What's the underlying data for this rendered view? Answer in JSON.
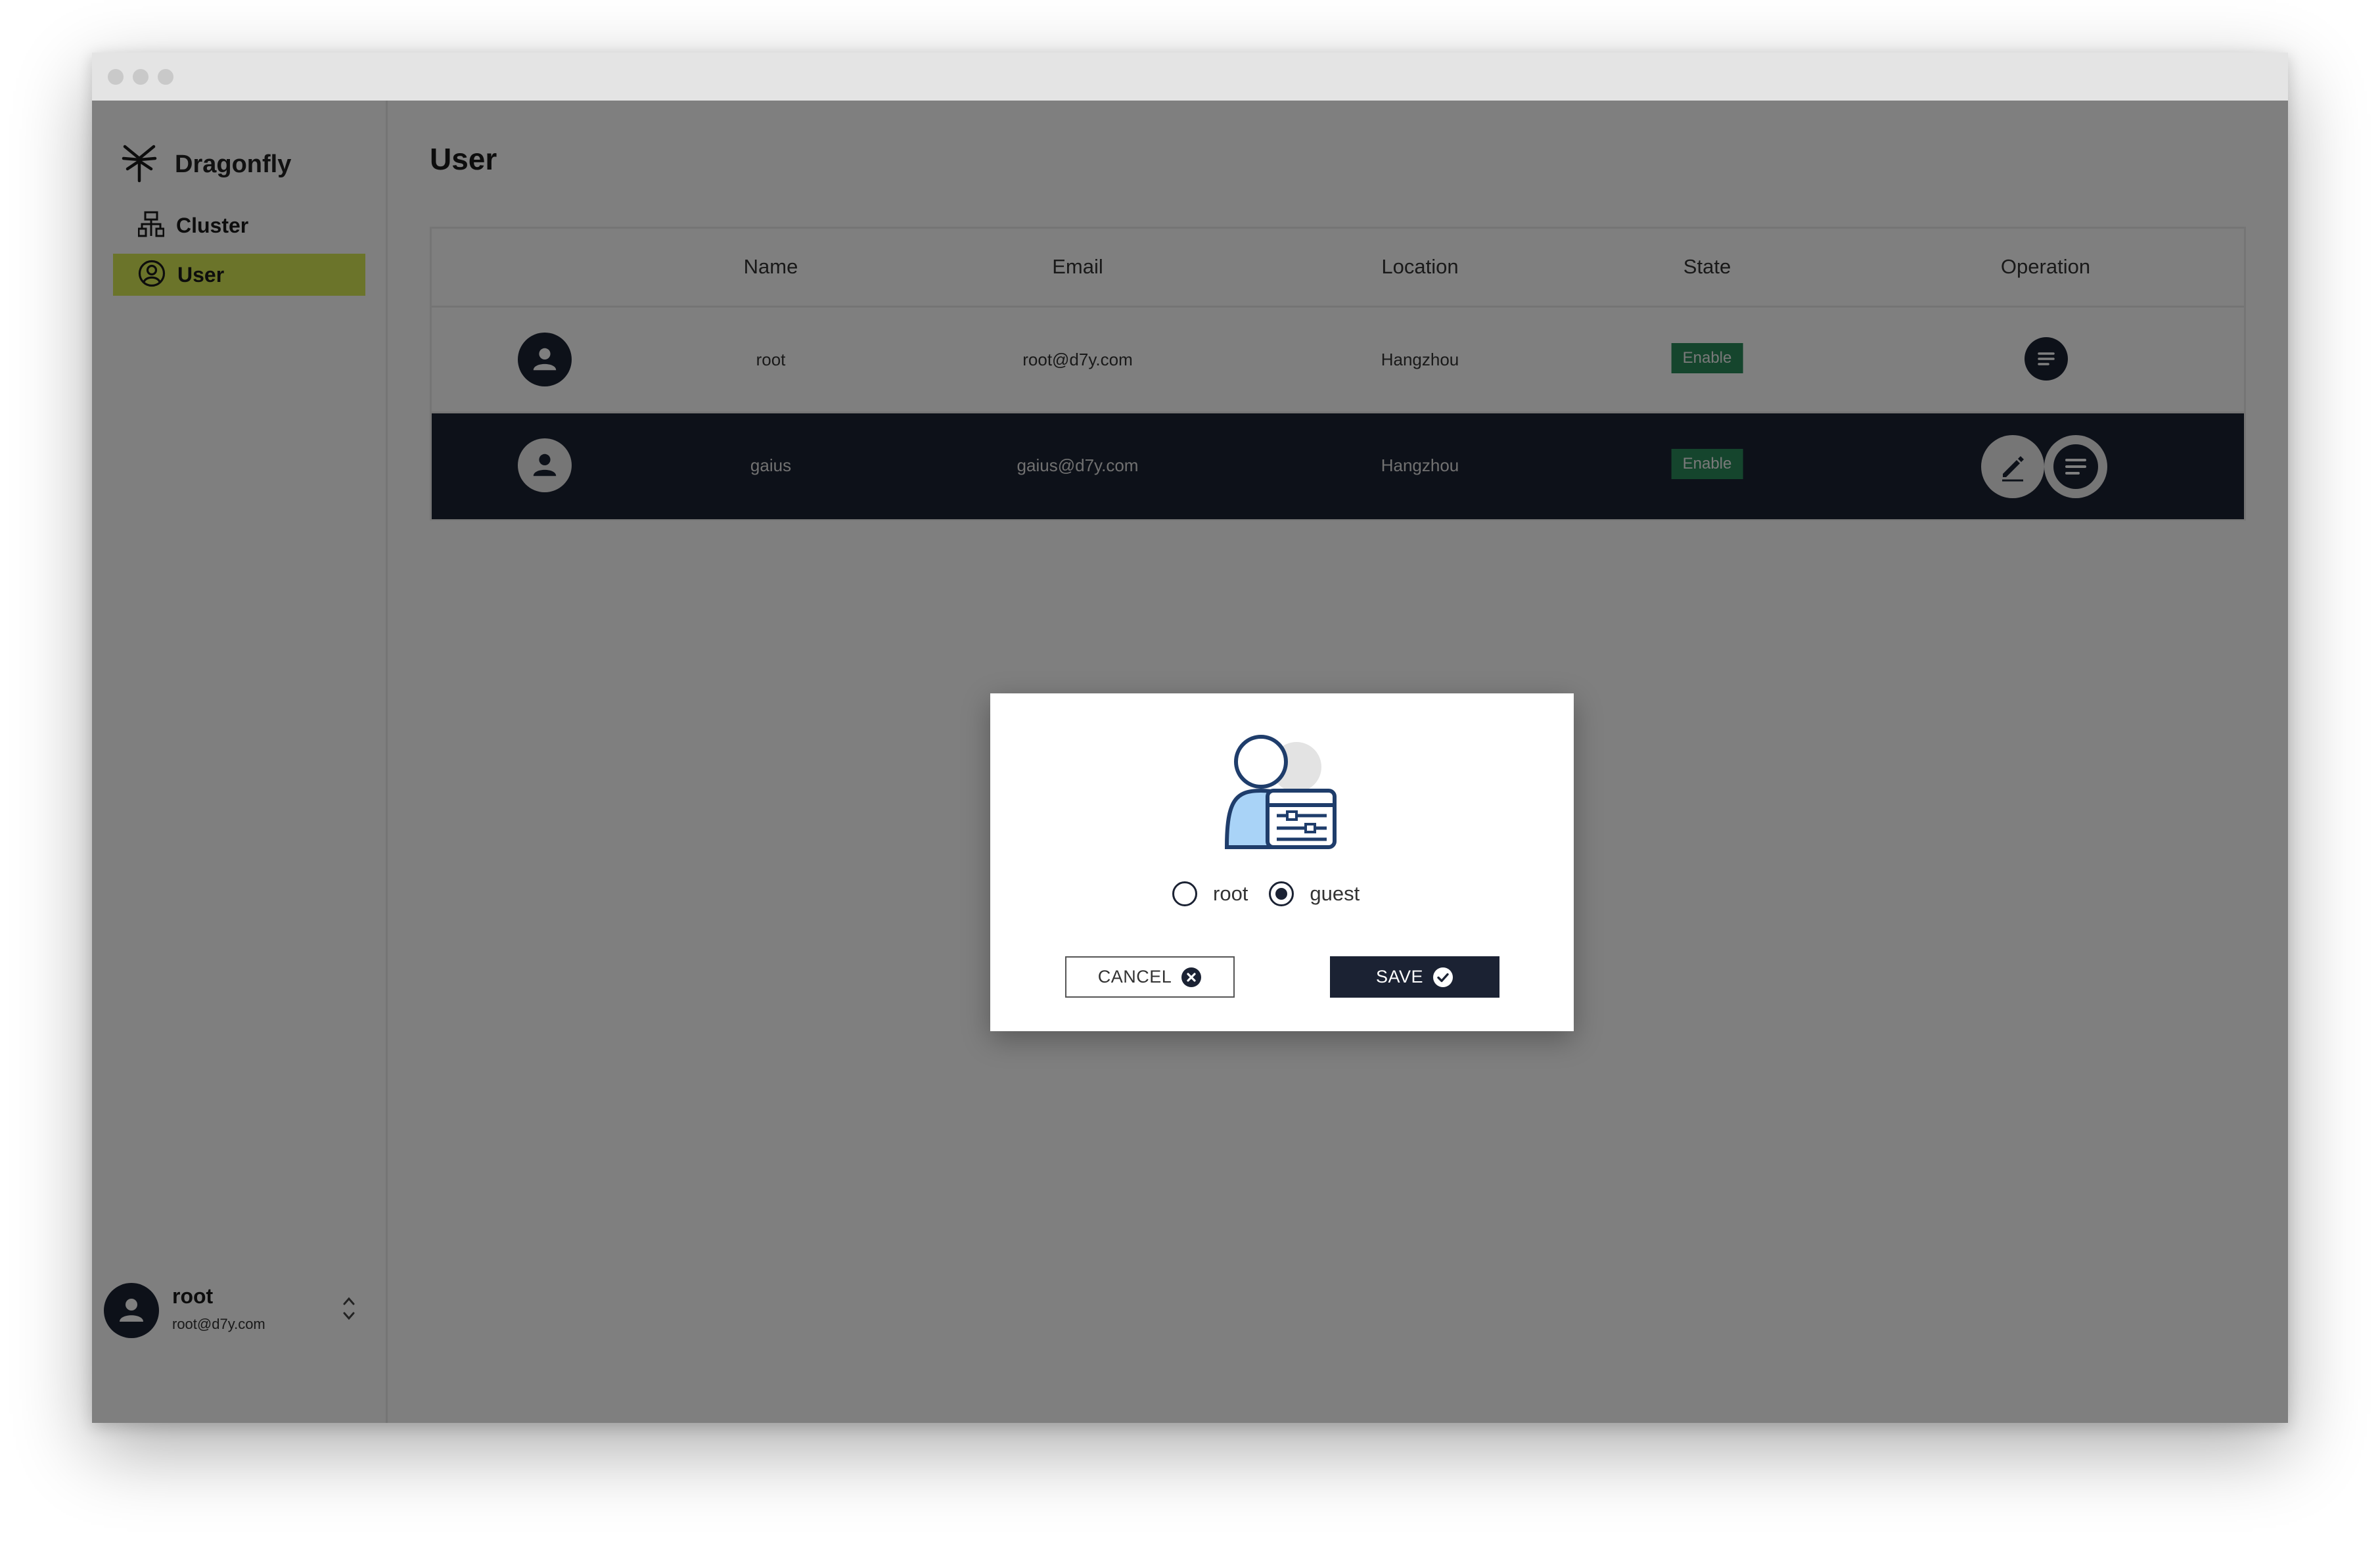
{
  "brand": {
    "name": "Dragonfly"
  },
  "sidebar": {
    "items": [
      {
        "label": "Cluster",
        "icon": "cluster-icon",
        "active": false
      },
      {
        "label": "User",
        "icon": "user-circle-icon",
        "active": true
      }
    ]
  },
  "profile": {
    "name": "root",
    "email": "root@d7y.com"
  },
  "page": {
    "title": "User"
  },
  "table": {
    "columns": [
      "Name",
      "Email",
      "Location",
      "State",
      "Operation"
    ],
    "rows": [
      {
        "name": "root",
        "email": "root@d7y.com",
        "location": "Hangzhou",
        "state": "Enable",
        "operations": [
          "detail-icon"
        ],
        "selected": false
      },
      {
        "name": "gaius",
        "email": "gaius@d7y.com",
        "location": "Hangzhou",
        "state": "Enable",
        "operations": [
          "edit-icon",
          "detail-icon"
        ],
        "selected": true
      }
    ]
  },
  "dialog": {
    "illustration": "user-settings-icon",
    "role_options": [
      {
        "label": "root",
        "selected": false
      },
      {
        "label": "guest",
        "selected": true
      }
    ],
    "cancel_label": "CANCEL",
    "save_label": "SAVE"
  },
  "colors": {
    "accent": "#d6e854",
    "dark": "#1b2233",
    "badge_green": "#2b8a5b",
    "overlay": "rgba(0,0,0,0.5)"
  }
}
